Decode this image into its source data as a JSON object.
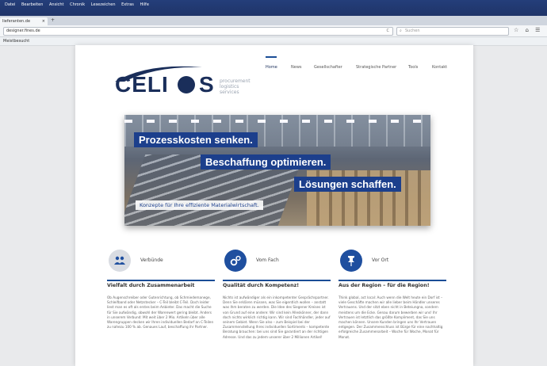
{
  "browser": {
    "menu": [
      "Datei",
      "Bearbeiten",
      "Ansicht",
      "Chronik",
      "Lesezeichen",
      "Extras",
      "Hilfe"
    ],
    "tab_label": "lieferanten.de",
    "new_tab": "+",
    "tab_close": "×",
    "url": "designer.fines.de",
    "reload": "C",
    "search_placeholder": "Suchen",
    "search_icon": "⌕",
    "toolbar_icons": "☆ ⌂ ☰",
    "bookmark": "Meistbesucht"
  },
  "site": {
    "logo_text": "CELI",
    "logo_s": "S",
    "tagline_1": "procurement",
    "tagline_2": "logistics",
    "tagline_3": "services",
    "nav": [
      "Home",
      "News",
      "Gesellschafter",
      "Strategische Partner",
      "Tools",
      "Kontakt"
    ]
  },
  "hero": {
    "claim_1": "Prozesskosten senken.",
    "claim_2": "Beschaffung optimieren.",
    "claim_3": "Lösungen schaffen.",
    "subline": "Konzepte für Ihre effiziente Materialwirtschaft."
  },
  "features": [
    {
      "icon": "users-icon",
      "label": "Verbünde",
      "title": "Vielfalt durch Zusammenarbeit",
      "text": "Ob Augenschreiber oder Gutenrichtung, ob Schmiedemanege, Schleifband oder Netzstecker – C-Teil bleibt C-Teil. Doch leider liest man es oft als erstes beim Anbieter. Das macht die Suche für Sie aufwändig, obwohl der Warenwert gering bleibt. Anders in unserem Verbund: Mit weit über 2 Mio. Artikeln über alle Warengruppen decken wir Ihren individuellen Bedarf an C-Teilen zu nahezu 100 % ab. Genaues Lauf, beschaffung ihr Partner."
    },
    {
      "icon": "gears-icon",
      "label": "Vom Fach",
      "title": "Qualität durch Kompetenz!",
      "text": "Nichts ist aufwändiger als ein inkompetenter Gesprächspartner. Denn Sie erklären müssen, was Sie eigentlich wollen – anstatt was Ihm beraten zu werden. Die Idee des Siegener Kreises ist von Grund auf eine andere: Wir sind kein Alleskönner, der dann doch nichts wirklich richtig kann. Wir sind Fachhändler, jeder auf seinem Gebiet. Wenn Sie also – zum Beispiel bei der Zusammenstellung Ihres individuellen Sortiments – kompetente Beratung brauchen: bei uns sind Sie garantiert an der richtigen Adresse. Und das zu jedem unserer über 2 Millionen Artikel!"
    },
    {
      "icon": "pin-icon",
      "label": "Vor Ort",
      "title": "Aus der Region – für die Region!",
      "text": "Think global, act local: Auch wenn die Welt heute ein Dorf ist – viele Geschäfte machen wir alle lieber beim Händler unseres Vertrauens. Und der sitzt eben nicht in Beteiungna, sondern meistens um die Ecke. Genau darum bewerben wir uns! Ihr Vertrauen ist letztlich das größte Kompliment, das Sie uns machen können. Unsere Kunden bringen uns Ihr Vertrauen entgegen. Der Zusammenschluss ist Bürge für eine nachhaltig erfolgreiche Zusammenarbeit – Woche für Woche, Monat für Monat."
    }
  ],
  "colors": {
    "brand": "#1a2e5a",
    "accent": "#1c3f8c",
    "icon_bg": "#1f4f9f",
    "icon_bg_muted": "#d9dce2"
  }
}
